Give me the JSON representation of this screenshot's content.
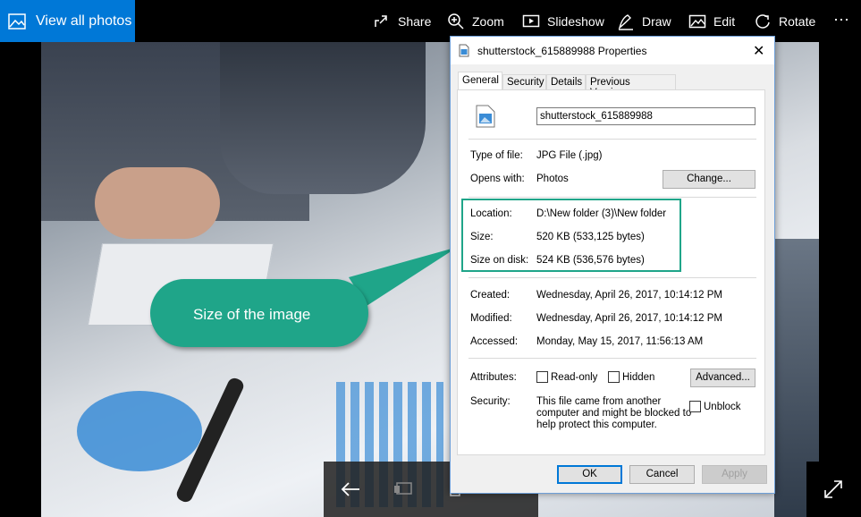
{
  "toolbar": {
    "view_all": "View all photos",
    "share": "Share",
    "zoom": "Zoom",
    "slideshow": "Slideshow",
    "draw": "Draw",
    "edit": "Edit",
    "rotate": "Rotate",
    "more": "⋯"
  },
  "dialog": {
    "title": "shutterstock_615889988 Properties",
    "tabs": [
      "General",
      "Security",
      "Details",
      "Previous Versions"
    ],
    "file_name": "shutterstock_615889988",
    "type_label": "Type of file:",
    "type_value": "JPG File (.jpg)",
    "opens_label": "Opens with:",
    "opens_value": "Photos",
    "change_btn": "Change...",
    "location_label": "Location:",
    "location_value": "D:\\New folder (3)\\New folder",
    "size_label": "Size:",
    "size_value": "520 KB (533,125 bytes)",
    "size_disk_label": "Size on disk:",
    "size_disk_value": "524 KB (536,576 bytes)",
    "created_label": "Created:",
    "created_value": "Wednesday, April 26, 2017, 10:14:12 PM",
    "modified_label": "Modified:",
    "modified_value": "Wednesday, April 26, 2017, 10:14:12 PM",
    "accessed_label": "Accessed:",
    "accessed_value": "Monday, May 15, 2017, 11:56:13 AM",
    "attributes_label": "Attributes:",
    "readonly": "Read-only",
    "hidden": "Hidden",
    "advanced_btn": "Advanced...",
    "security_label": "Security:",
    "security_text_1": "This file came from another",
    "security_text_2": "computer and might be blocked to",
    "security_text_3": "help protect this computer.",
    "unblock": "Unblock",
    "ok": "OK",
    "cancel": "Cancel",
    "apply": "Apply"
  },
  "callout": {
    "text": "Size of the image"
  },
  "colors": {
    "accent": "#0078d7",
    "callout": "#1fa589"
  }
}
